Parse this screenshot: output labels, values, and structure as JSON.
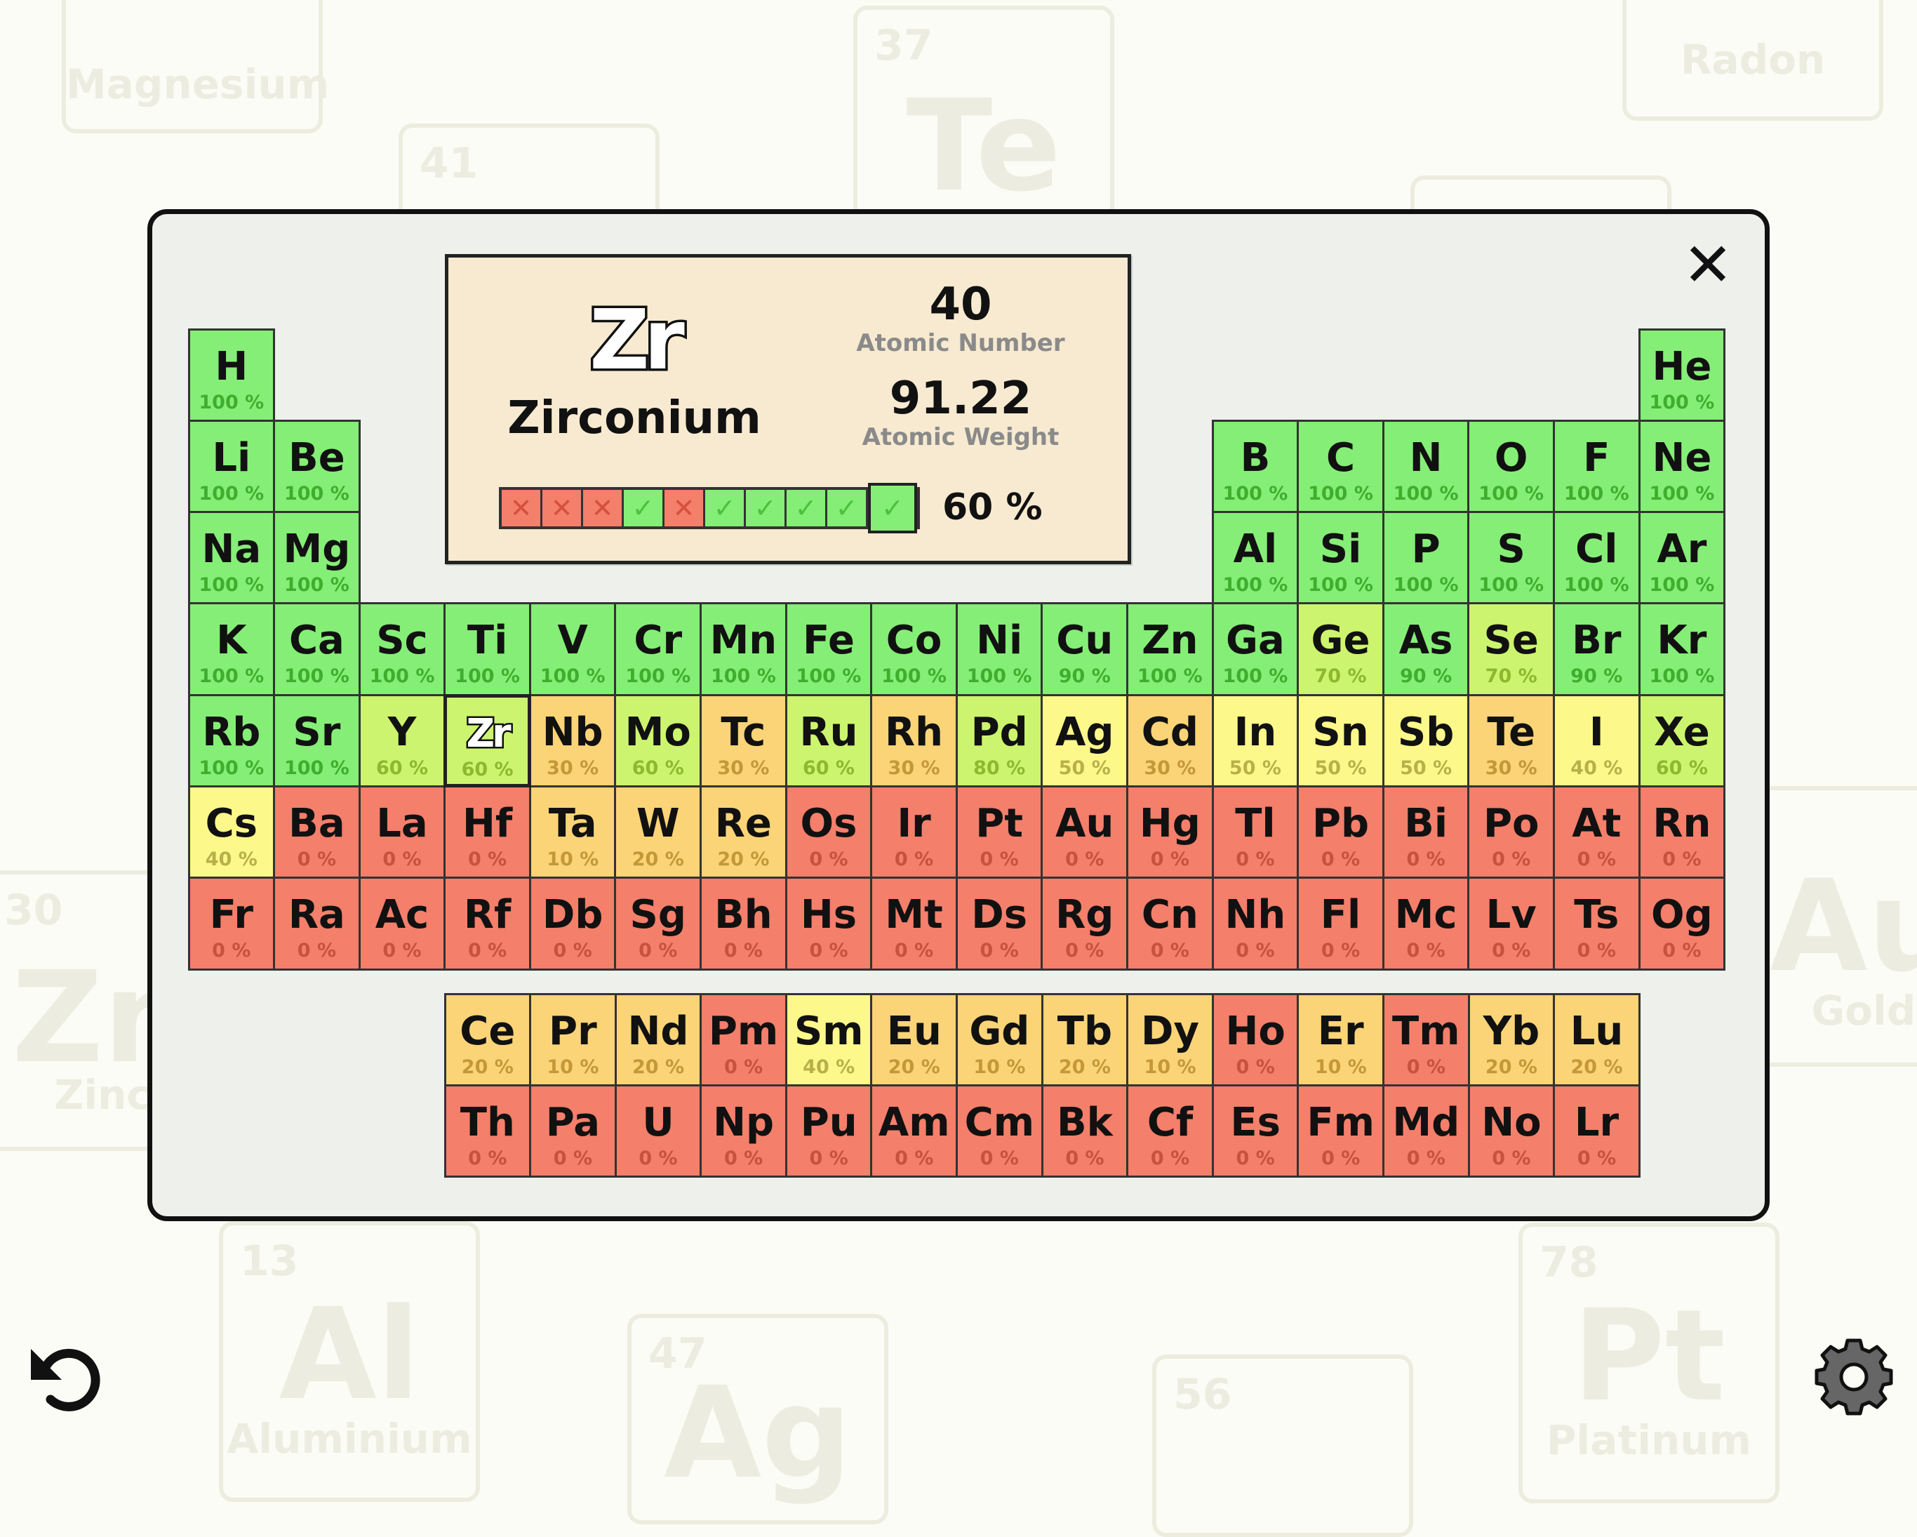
{
  "background_tiles": [
    {
      "name": "Magnesium"
    },
    {
      "number": "37",
      "symbol": "Te"
    },
    {
      "name": "Radon"
    },
    {
      "number": "41"
    },
    {
      "number": "30",
      "symbol": "Zn",
      "name": "Zinc"
    },
    {
      "symbol": "Au",
      "name": "Gold"
    },
    {
      "number": "13",
      "symbol": "Al",
      "name": "Aluminium"
    },
    {
      "number": "47",
      "symbol": "Ag"
    },
    {
      "number": "56"
    },
    {
      "number": "78",
      "symbol": "Pt",
      "name": "Platinum"
    }
  ],
  "info_card": {
    "symbol": "Zr",
    "name": "Zirconium",
    "atomic_number": "40",
    "atomic_number_label": "Atomic Number",
    "atomic_weight": "91.22",
    "atomic_weight_label": "Atomic Weight",
    "score": "60 %",
    "attempts": [
      "fail",
      "fail",
      "fail",
      "pass",
      "fail",
      "pass",
      "pass",
      "pass",
      "pass",
      "pass"
    ]
  },
  "icons": {
    "close": "close-icon",
    "undo": "undo-icon",
    "settings": "gear-icon"
  },
  "colors": {
    "green": "#85ee76",
    "yellowgreen": "#cdf46e",
    "yellow": "#fdf88a",
    "orange": "#fbd477",
    "red": "#f47f6b"
  },
  "selected_element": "Zr",
  "elements": [
    {
      "s": "H",
      "p": "100 %"
    },
    {
      "s": "He",
      "p": "100 %"
    },
    {
      "s": "Li",
      "p": "100 %"
    },
    {
      "s": "Be",
      "p": "100 %"
    },
    {
      "s": "B",
      "p": "100 %"
    },
    {
      "s": "C",
      "p": "100 %"
    },
    {
      "s": "N",
      "p": "100 %"
    },
    {
      "s": "O",
      "p": "100 %"
    },
    {
      "s": "F",
      "p": "100 %"
    },
    {
      "s": "Ne",
      "p": "100 %"
    },
    {
      "s": "Na",
      "p": "100 %"
    },
    {
      "s": "Mg",
      "p": "100 %"
    },
    {
      "s": "Al",
      "p": "100 %"
    },
    {
      "s": "Si",
      "p": "100 %"
    },
    {
      "s": "P",
      "p": "100 %"
    },
    {
      "s": "S",
      "p": "100 %"
    },
    {
      "s": "Cl",
      "p": "100 %"
    },
    {
      "s": "Ar",
      "p": "100 %"
    },
    {
      "s": "K",
      "p": "100 %"
    },
    {
      "s": "Ca",
      "p": "100 %"
    },
    {
      "s": "Sc",
      "p": "100 %"
    },
    {
      "s": "Ti",
      "p": "100 %"
    },
    {
      "s": "V",
      "p": "100 %"
    },
    {
      "s": "Cr",
      "p": "100 %"
    },
    {
      "s": "Mn",
      "p": "100 %"
    },
    {
      "s": "Fe",
      "p": "100 %"
    },
    {
      "s": "Co",
      "p": "100 %"
    },
    {
      "s": "Ni",
      "p": "100 %"
    },
    {
      "s": "Cu",
      "p": "90 %"
    },
    {
      "s": "Zn",
      "p": "100 %"
    },
    {
      "s": "Ga",
      "p": "100 %"
    },
    {
      "s": "Ge",
      "p": "70 %"
    },
    {
      "s": "As",
      "p": "90 %"
    },
    {
      "s": "Se",
      "p": "70 %"
    },
    {
      "s": "Br",
      "p": "90 %"
    },
    {
      "s": "Kr",
      "p": "100 %"
    },
    {
      "s": "Rb",
      "p": "100 %"
    },
    {
      "s": "Sr",
      "p": "100 %"
    },
    {
      "s": "Y",
      "p": "60 %"
    },
    {
      "s": "Zr",
      "p": "60 %"
    },
    {
      "s": "Nb",
      "p": "30 %"
    },
    {
      "s": "Mo",
      "p": "60 %"
    },
    {
      "s": "Tc",
      "p": "30 %"
    },
    {
      "s": "Ru",
      "p": "60 %"
    },
    {
      "s": "Rh",
      "p": "30 %"
    },
    {
      "s": "Pd",
      "p": "80 %"
    },
    {
      "s": "Ag",
      "p": "50 %"
    },
    {
      "s": "Cd",
      "p": "30 %"
    },
    {
      "s": "In",
      "p": "50 %"
    },
    {
      "s": "Sn",
      "p": "50 %"
    },
    {
      "s": "Sb",
      "p": "50 %"
    },
    {
      "s": "Te",
      "p": "30 %"
    },
    {
      "s": "I",
      "p": "40 %"
    },
    {
      "s": "Xe",
      "p": "60 %"
    },
    {
      "s": "Cs",
      "p": "40 %"
    },
    {
      "s": "Ba",
      "p": "0 %"
    },
    {
      "s": "La",
      "p": "0 %"
    },
    {
      "s": "Hf",
      "p": "0 %"
    },
    {
      "s": "Ta",
      "p": "10 %"
    },
    {
      "s": "W",
      "p": "20 %"
    },
    {
      "s": "Re",
      "p": "20 %"
    },
    {
      "s": "Os",
      "p": "0 %"
    },
    {
      "s": "Ir",
      "p": "0 %"
    },
    {
      "s": "Pt",
      "p": "0 %"
    },
    {
      "s": "Au",
      "p": "0 %"
    },
    {
      "s": "Hg",
      "p": "0 %"
    },
    {
      "s": "Tl",
      "p": "0 %"
    },
    {
      "s": "Pb",
      "p": "0 %"
    },
    {
      "s": "Bi",
      "p": "0 %"
    },
    {
      "s": "Po",
      "p": "0 %"
    },
    {
      "s": "At",
      "p": "0 %"
    },
    {
      "s": "Rn",
      "p": "0 %"
    },
    {
      "s": "Fr",
      "p": "0 %"
    },
    {
      "s": "Ra",
      "p": "0 %"
    },
    {
      "s": "Ac",
      "p": "0 %"
    },
    {
      "s": "Rf",
      "p": "0 %"
    },
    {
      "s": "Db",
      "p": "0 %"
    },
    {
      "s": "Sg",
      "p": "0 %"
    },
    {
      "s": "Bh",
      "p": "0 %"
    },
    {
      "s": "Hs",
      "p": "0 %"
    },
    {
      "s": "Mt",
      "p": "0 %"
    },
    {
      "s": "Ds",
      "p": "0 %"
    },
    {
      "s": "Rg",
      "p": "0 %"
    },
    {
      "s": "Cn",
      "p": "0 %"
    },
    {
      "s": "Nh",
      "p": "0 %"
    },
    {
      "s": "Fl",
      "p": "0 %"
    },
    {
      "s": "Mc",
      "p": "0 %"
    },
    {
      "s": "Lv",
      "p": "0 %"
    },
    {
      "s": "Ts",
      "p": "0 %"
    },
    {
      "s": "Og",
      "p": "0 %"
    }
  ],
  "f_block": [
    {
      "s": "Ce",
      "p": "20 %"
    },
    {
      "s": "Pr",
      "p": "10 %"
    },
    {
      "s": "Nd",
      "p": "20 %"
    },
    {
      "s": "Pm",
      "p": "0 %"
    },
    {
      "s": "Sm",
      "p": "40 %"
    },
    {
      "s": "Eu",
      "p": "20 %"
    },
    {
      "s": "Gd",
      "p": "10 %"
    },
    {
      "s": "Tb",
      "p": "20 %"
    },
    {
      "s": "Dy",
      "p": "10 %"
    },
    {
      "s": "Ho",
      "p": "0 %"
    },
    {
      "s": "Er",
      "p": "10 %"
    },
    {
      "s": "Tm",
      "p": "0 %"
    },
    {
      "s": "Yb",
      "p": "20 %"
    },
    {
      "s": "Lu",
      "p": "20 %"
    },
    {
      "s": "Th",
      "p": "0 %"
    },
    {
      "s": "Pa",
      "p": "0 %"
    },
    {
      "s": "U",
      "p": "0 %"
    },
    {
      "s": "Np",
      "p": "0 %"
    },
    {
      "s": "Pu",
      "p": "0 %"
    },
    {
      "s": "Am",
      "p": "0 %"
    },
    {
      "s": "Cm",
      "p": "0 %"
    },
    {
      "s": "Bk",
      "p": "0 %"
    },
    {
      "s": "Cf",
      "p": "0 %"
    },
    {
      "s": "Es",
      "p": "0 %"
    },
    {
      "s": "Fm",
      "p": "0 %"
    },
    {
      "s": "Md",
      "p": "0 %"
    },
    {
      "s": "No",
      "p": "0 %"
    },
    {
      "s": "Lr",
      "p": "0 %"
    }
  ]
}
